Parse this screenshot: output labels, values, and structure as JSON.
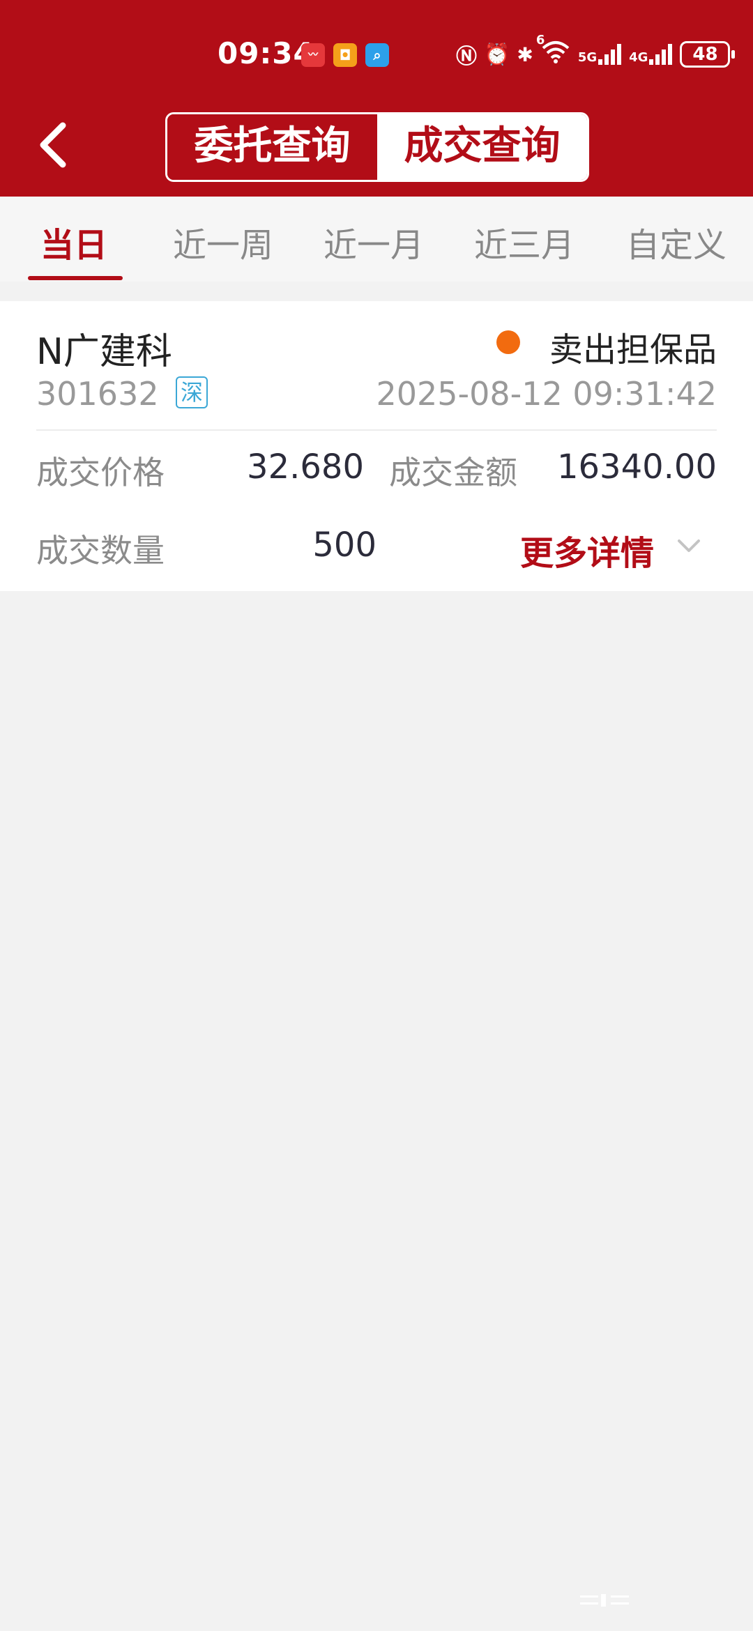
{
  "status_bar": {
    "time": "09:34",
    "battery": "48",
    "icons": [
      "nfc-icon",
      "alarm-icon",
      "bluetooth-icon",
      "wifi-icon",
      "signal-5g-icon",
      "signal-4g-icon",
      "battery-icon"
    ],
    "network_5g": "5G",
    "network_4g": "4G",
    "wifi_label": "6"
  },
  "header": {
    "segment_tabs": [
      {
        "label": "委托查询",
        "active": false
      },
      {
        "label": "成交查询",
        "active": true
      }
    ]
  },
  "tabs": [
    "当日",
    "近一周",
    "近一月",
    "近三月",
    "自定义"
  ],
  "active_tab": "当日",
  "trade": {
    "name": "N广建科",
    "code": "301632",
    "exchange": "深",
    "type": "卖出担保品",
    "datetime": "2025-08-12 09:31:42",
    "price_label": "成交价格",
    "price": "32.680",
    "amount_label": "成交金额",
    "amount": "16340.00",
    "quantity_label": "成交数量",
    "quantity": "500",
    "more_label": "更多详情"
  },
  "colors": {
    "brand_red": "#b20d17",
    "status_dot": "#f26b0f",
    "exchange_badge": "#3ba7d6"
  }
}
